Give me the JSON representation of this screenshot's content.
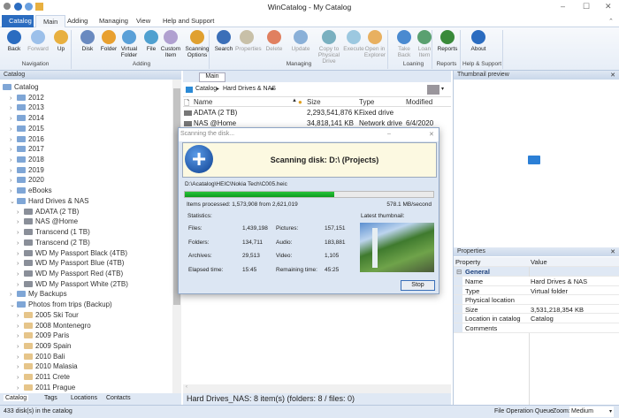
{
  "window": {
    "title": "WinCatalog - My Catalog"
  },
  "ribbon_tabs": [
    "Catalog",
    "Main",
    "Adding",
    "Managing",
    "View",
    "Help and Support"
  ],
  "ribbon": {
    "buttons": [
      {
        "label": "Back",
        "enabled": true,
        "icon": "back-icon"
      },
      {
        "label": "Forward",
        "enabled": false,
        "icon": "forward-icon"
      },
      {
        "label": "Up",
        "enabled": true,
        "icon": "up-folder-icon"
      },
      {
        "label": "Disk",
        "enabled": true,
        "icon": "add-disk-icon"
      },
      {
        "label": "Folder",
        "enabled": true,
        "icon": "add-folder-icon"
      },
      {
        "label": "Virtual Folder",
        "enabled": true,
        "icon": "virtual-folder-icon"
      },
      {
        "label": "File",
        "enabled": true,
        "icon": "add-file-icon"
      },
      {
        "label": "Custom Item",
        "enabled": true,
        "icon": "custom-item-icon"
      },
      {
        "label": "Scanning Options",
        "enabled": true,
        "icon": "gear-icon"
      },
      {
        "label": "Search",
        "enabled": true,
        "icon": "search-icon"
      },
      {
        "label": "Properties",
        "enabled": false,
        "icon": "properties-icon"
      },
      {
        "label": "Delete",
        "enabled": false,
        "icon": "delete-icon"
      },
      {
        "label": "Update",
        "enabled": false,
        "icon": "update-icon"
      },
      {
        "label": "Copy to Physical Drive",
        "enabled": false,
        "icon": "copy-icon"
      },
      {
        "label": "Execute",
        "enabled": false,
        "icon": "execute-icon"
      },
      {
        "label": "Open in Explorer",
        "enabled": false,
        "icon": "explorer-icon"
      },
      {
        "label": "Take Back",
        "enabled": false,
        "icon": "take-back-icon"
      },
      {
        "label": "Loan Item",
        "enabled": false,
        "icon": "loan-icon"
      },
      {
        "label": "Reports",
        "enabled": true,
        "icon": "reports-icon"
      },
      {
        "label": "About",
        "enabled": true,
        "icon": "info-icon"
      }
    ],
    "groups": [
      "Navigation",
      "Adding",
      "Managing",
      "Loaning",
      "Reports",
      "Help & Support"
    ]
  },
  "catalog_panel": {
    "title": "Catalog",
    "items": [
      {
        "label": "Catalog",
        "level": 0,
        "kind": "folder"
      },
      {
        "label": "2012",
        "level": 1,
        "kind": "folder"
      },
      {
        "label": "2013",
        "level": 1,
        "kind": "folder"
      },
      {
        "label": "2014",
        "level": 1,
        "kind": "folder"
      },
      {
        "label": "2015",
        "level": 1,
        "kind": "folder"
      },
      {
        "label": "2016",
        "level": 1,
        "kind": "folder"
      },
      {
        "label": "2017",
        "level": 1,
        "kind": "folder"
      },
      {
        "label": "2018",
        "level": 1,
        "kind": "folder"
      },
      {
        "label": "2019",
        "level": 1,
        "kind": "folder"
      },
      {
        "label": "2020",
        "level": 1,
        "kind": "folder"
      },
      {
        "label": "eBooks",
        "level": 1,
        "kind": "folder"
      },
      {
        "label": "Hard Drives & NAS",
        "level": 1,
        "kind": "folder",
        "expanded": true
      },
      {
        "label": "ADATA (2 TB)",
        "level": 2,
        "kind": "drive"
      },
      {
        "label": "NAS @Home",
        "level": 2,
        "kind": "drive"
      },
      {
        "label": "Transcend (1 TB)",
        "level": 2,
        "kind": "drive"
      },
      {
        "label": "Transcend (2 TB)",
        "level": 2,
        "kind": "drive"
      },
      {
        "label": "WD My Passport Black (4TB)",
        "level": 2,
        "kind": "drive"
      },
      {
        "label": "WD My Passport Blue (4TB)",
        "level": 2,
        "kind": "drive"
      },
      {
        "label": "WD My Passport Red (4TB)",
        "level": 2,
        "kind": "drive"
      },
      {
        "label": "WD My Passport White (2TB)",
        "level": 2,
        "kind": "drive"
      },
      {
        "label": "My Backups",
        "level": 1,
        "kind": "folder"
      },
      {
        "label": "Photos from trips (Backup)",
        "level": 1,
        "kind": "folder",
        "expanded": true
      },
      {
        "label": "2005 Ski Tour",
        "level": 2,
        "kind": "photo"
      },
      {
        "label": "2008 Montenegro",
        "level": 2,
        "kind": "photo"
      },
      {
        "label": "2009 Paris",
        "level": 2,
        "kind": "photo"
      },
      {
        "label": "2009 Spain",
        "level": 2,
        "kind": "photo"
      },
      {
        "label": "2010 Bali",
        "level": 2,
        "kind": "photo"
      },
      {
        "label": "2010 Malasia",
        "level": 2,
        "kind": "photo"
      },
      {
        "label": "2011 Crete",
        "level": 2,
        "kind": "photo"
      },
      {
        "label": "2011 Prague",
        "level": 2,
        "kind": "photo"
      }
    ],
    "bottom_tabs": [
      "Catalog",
      "Tags",
      "Locations",
      "Contacts"
    ]
  },
  "main": {
    "tab": "Main",
    "breadcrumb": [
      "Catalog",
      "Hard Drives & NAS"
    ],
    "columns": [
      "Name",
      "Size",
      "Type",
      "Modified"
    ],
    "rows": [
      {
        "name": "ADATA (2 TB)",
        "size": "2,293,541,876 K...",
        "type": "Fixed drive",
        "modified": ""
      },
      {
        "name": "NAS @Home",
        "size": "34,818,141 KB",
        "type": "Network drive",
        "modified": "6/4/2020"
      }
    ],
    "status": "Hard Drives_NAS: 8 item(s) (folders: 8 / files: 0)"
  },
  "dialog": {
    "title": "Scanning the disk...",
    "heading": "Scanning disk: D:\\ (Projects)",
    "path": "D:\\Acatalog\\HEIC\\Nokia Tech\\C005.heic",
    "progress": 0.6,
    "items_processed": "Items processed: 1,573,908 from 2,621,019",
    "speed": "578.1 MB/second",
    "statistics_label": "Statistics:",
    "thumbnail_label": "Latest thumbnail:",
    "stats": [
      {
        "label": "Files:",
        "value": "1,439,198"
      },
      {
        "label": "Folders:",
        "value": "134,711"
      },
      {
        "label": "Archives:",
        "value": "29,513"
      },
      {
        "label": "Elapsed time:",
        "value": "15:45"
      }
    ],
    "stats2": [
      {
        "label": "Pictures:",
        "value": "157,151"
      },
      {
        "label": "Audio:",
        "value": "183,881"
      },
      {
        "label": "Video:",
        "value": "1,105"
      },
      {
        "label": "Remaining time:",
        "value": "45:25"
      }
    ],
    "stop_label": "Stop"
  },
  "thumbnail_panel": {
    "title": "Thumbnail preview"
  },
  "properties": {
    "title": "Properties",
    "col_property": "Property",
    "col_value": "Value",
    "group": "General",
    "rows": [
      {
        "property": "Name",
        "value": "Hard Drives & NAS"
      },
      {
        "property": "Type",
        "value": "Virtual folder"
      },
      {
        "property": "Physical location",
        "value": ""
      },
      {
        "property": "Size",
        "value": "3,531,218,354 KB"
      },
      {
        "property": "Location in catalog",
        "value": "Catalog"
      },
      {
        "property": "Comments",
        "value": ""
      }
    ]
  },
  "statusbar": {
    "left": "433 disk(s) in the catalog",
    "queue": "File Operation Queue",
    "zoom_label": "Zoom:",
    "zoom_value": "Medium"
  },
  "colors": {
    "accent": "#2b6cc0",
    "progress": "#12a524",
    "panel": "#dfe8f4"
  }
}
